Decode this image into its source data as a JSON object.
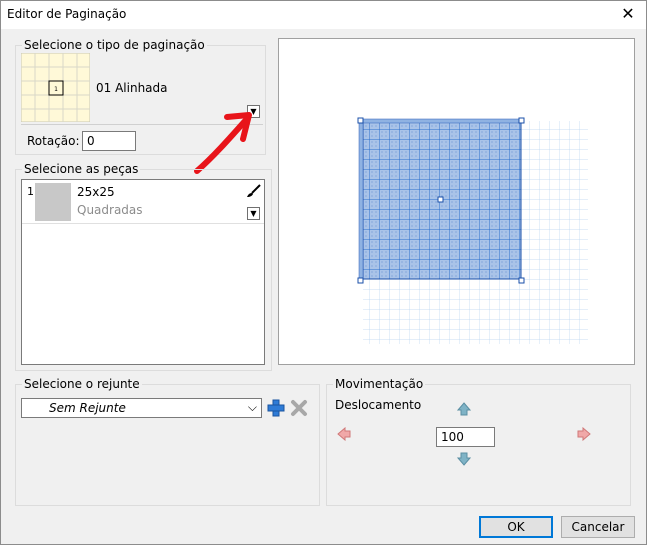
{
  "window": {
    "title": "Editor de Paginação"
  },
  "pagination": {
    "group_label": "Selecione o tipo de paginação",
    "selected_name": "01 Alinhada",
    "thumb_number": "1",
    "rotation_label": "Rotação:",
    "rotation_value": "0"
  },
  "pieces": {
    "group_label": "Selecione as peças",
    "items": [
      {
        "index": "1",
        "size": "25x25",
        "type": "Quadradas"
      }
    ]
  },
  "grout": {
    "group_label": "Selecione o rejunte",
    "selected": "Sem Rejunte"
  },
  "movement": {
    "group_label": "Movimentação",
    "offset_label": "Deslocamento",
    "offset_value": "100"
  },
  "buttons": {
    "ok": "OK",
    "cancel": "Cancelar"
  },
  "colors": {
    "accent": "#0078d7",
    "annotation_arrow": "#e8141a",
    "tile_fill": "#aac4e6",
    "tile_line": "#1a63c4",
    "thumb_fill": "#fff9d8"
  }
}
